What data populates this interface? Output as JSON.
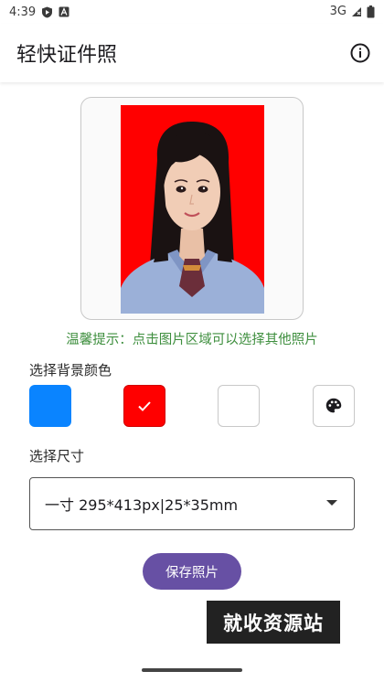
{
  "status_bar": {
    "time": "4:39",
    "network": "3G"
  },
  "app_bar": {
    "title": "轻快证件照"
  },
  "photo": {
    "background_color": "#ff0000"
  },
  "hint": "温馨提示：点击图片区域可以选择其他照片",
  "background_section": {
    "label": "选择背景颜色",
    "options": [
      {
        "color": "#0a84ff",
        "selected": false
      },
      {
        "color": "#ff0000",
        "selected": true
      },
      {
        "color": "#ffffff",
        "selected": false
      },
      {
        "color": "custom",
        "icon": "palette-icon",
        "selected": false
      }
    ]
  },
  "size_section": {
    "label": "选择尺寸",
    "selected_value": "一寸 295*413px|25*35mm"
  },
  "save_button": {
    "label": "保存照片"
  },
  "watermark": "就收资源站"
}
